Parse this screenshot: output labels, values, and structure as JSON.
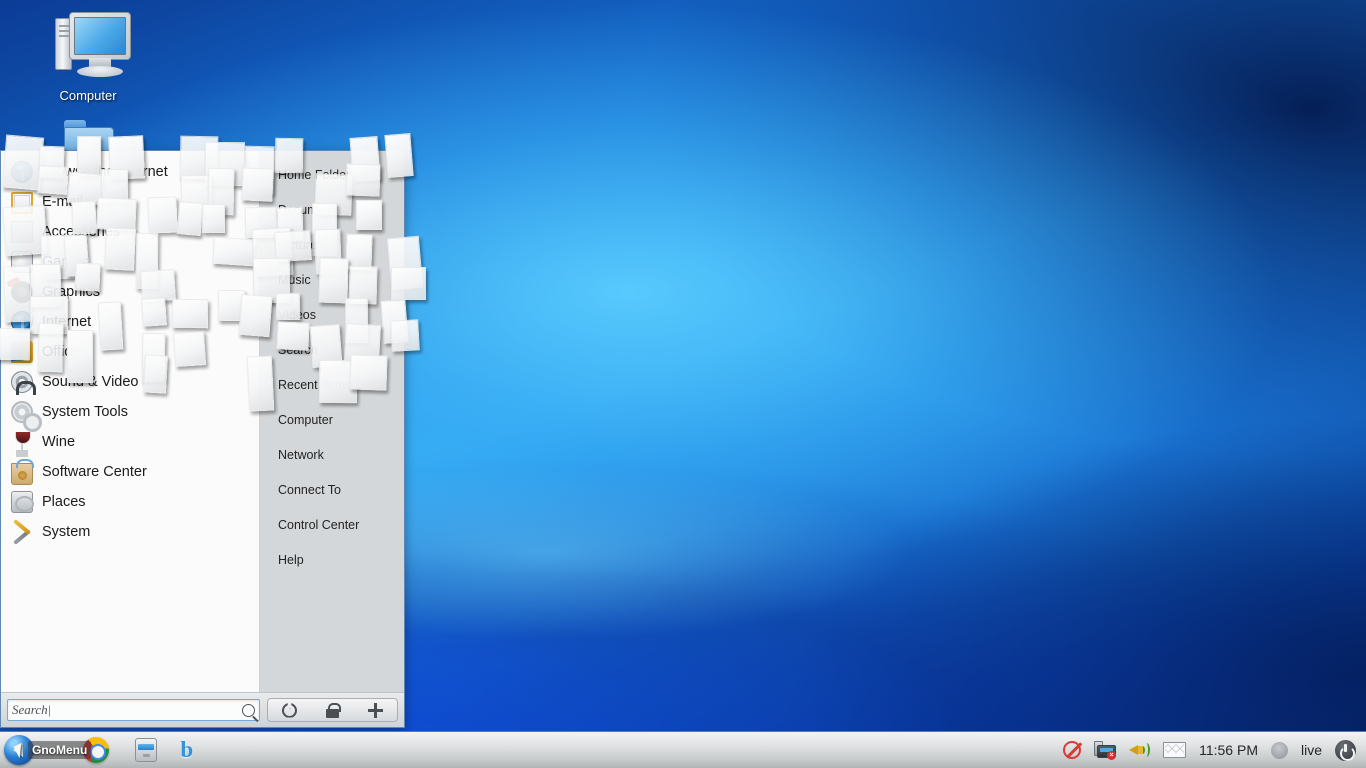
{
  "desktop": {
    "icons": [
      {
        "label": "Computer",
        "icon": "computer-icon"
      },
      {
        "label": "",
        "icon": "home-folder-icon"
      }
    ]
  },
  "menu": {
    "left_column": [
      {
        "label": "Browse the Internet",
        "icon": "globe-icon"
      },
      {
        "label": "E-mail",
        "icon": "mail-icon"
      },
      {
        "label": "Accessories",
        "icon": "accessories-icon"
      },
      {
        "label": "Games",
        "icon": "games-icon"
      },
      {
        "label": "Graphics",
        "icon": "graphics-icon"
      },
      {
        "label": "Internet",
        "icon": "globe-icon"
      },
      {
        "label": "Office",
        "icon": "office-icon"
      },
      {
        "label": "Sound & Video",
        "icon": "sound-video-icon"
      },
      {
        "label": "System Tools",
        "icon": "system-tools-icon"
      },
      {
        "label": "Wine",
        "icon": "wine-icon"
      },
      {
        "label": "Software Center",
        "icon": "software-center-icon"
      },
      {
        "label": "Places",
        "icon": "places-icon"
      },
      {
        "label": "System",
        "icon": "system-icon"
      }
    ],
    "right_column": [
      {
        "label": "Home Folder"
      },
      {
        "label": "Documents"
      },
      {
        "label": "Pictures"
      },
      {
        "label": "Music"
      },
      {
        "label": "Videos"
      },
      {
        "label": "Search"
      },
      {
        "label": "Recent Items"
      },
      {
        "label": "Computer"
      },
      {
        "label": "Network"
      },
      {
        "label": "Connect To"
      },
      {
        "label": "Control Center"
      },
      {
        "label": "Help"
      }
    ],
    "search": {
      "value": "Search|",
      "placeholder": "Search",
      "icon": "magnifier-icon"
    },
    "system_buttons": [
      {
        "name": "power-button",
        "icon": "power-icon"
      },
      {
        "name": "lock-button",
        "icon": "lock-icon"
      },
      {
        "name": "add-button",
        "icon": "plus-icon"
      }
    ]
  },
  "taskbar": {
    "start_button": {
      "label": "GnoMenu",
      "icon": "gnomenu-orb-icon"
    },
    "launchers": [
      {
        "name": "chrome",
        "icon": "chrome-icon"
      },
      {
        "name": "file-manager",
        "icon": "file-manager-icon"
      },
      {
        "name": "banshee",
        "icon": "banshee-b-icon"
      }
    ],
    "tray": {
      "no_entry": "no-entry-icon",
      "network": "network-disconnected-icon",
      "volume": "volume-icon",
      "mail": "mail-icon",
      "time": "11:56 PM",
      "avatar": "user-avatar-icon",
      "user": "live",
      "power": "power-icon"
    }
  },
  "colors": {
    "accent": "#2e86e0",
    "wallpaper_light": "#4ab9f0",
    "wallpaper_dark": "#06255f",
    "panel_left": "#fbfbfb",
    "panel_right": "#d4d7d9",
    "alert_red": "#d93b33"
  }
}
